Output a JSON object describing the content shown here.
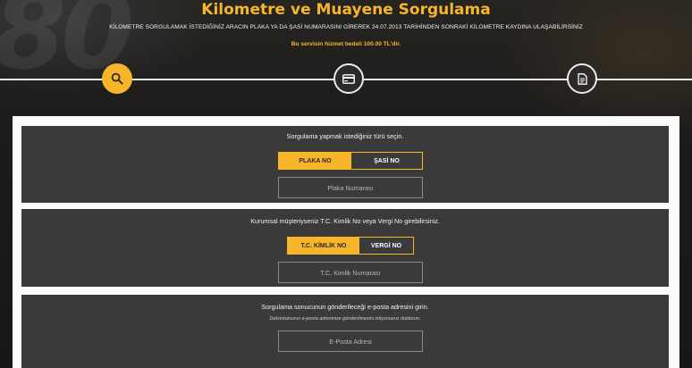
{
  "header": {
    "bg_digits": "80",
    "title": "Kilometre ve Muayene Sorgulama",
    "description": "KİLOMETRE SORGULAMAK İSTEDİĞİNİZ ARACIN PLAKA YA DA ŞASİ NUMARASINI GİREREK 24.07.2013 TARİHİNDEN SONRAKİ KİLOMETRE KAYDINA ULAŞABİLİRSİNİZ",
    "fee_note": "Bu servisin hizmet bedeli 100.00 TL'dir."
  },
  "steps": [
    {
      "icon": "search-icon",
      "active": true
    },
    {
      "icon": "credit-card-icon",
      "active": false
    },
    {
      "icon": "document-icon",
      "active": false
    }
  ],
  "query_type": {
    "label": "Sorgulama yapmak istediğiniz türü seçin.",
    "options": [
      "PLAKA NO",
      "ŞASİ NO"
    ],
    "selected": "PLAKA NO",
    "input_placeholder": "Plaka Numarası"
  },
  "corporate": {
    "label": "Kurumsal müşteriyseniz T.C. Kimlik No veya Vergi No girebilirsiniz.",
    "options": [
      "T.C. KİMLİK NO",
      "VERGİ NO"
    ],
    "selected": "T.C. KİMLİK NO",
    "input_placeholder": "T.C. Kimlik Numarası"
  },
  "email": {
    "label": "Sorgulama sonucunun gönderileceği e-posta adresini girin.",
    "note": "Dekontunuzun e-posta adresinize gönderilmesini istiyorsanız doldurun.",
    "input_placeholder": "E-Posta Adresi"
  },
  "colors": {
    "accent": "#f7b62a",
    "section_bg": "#3a3a3a",
    "panel_bg": "#fbfbfb"
  }
}
